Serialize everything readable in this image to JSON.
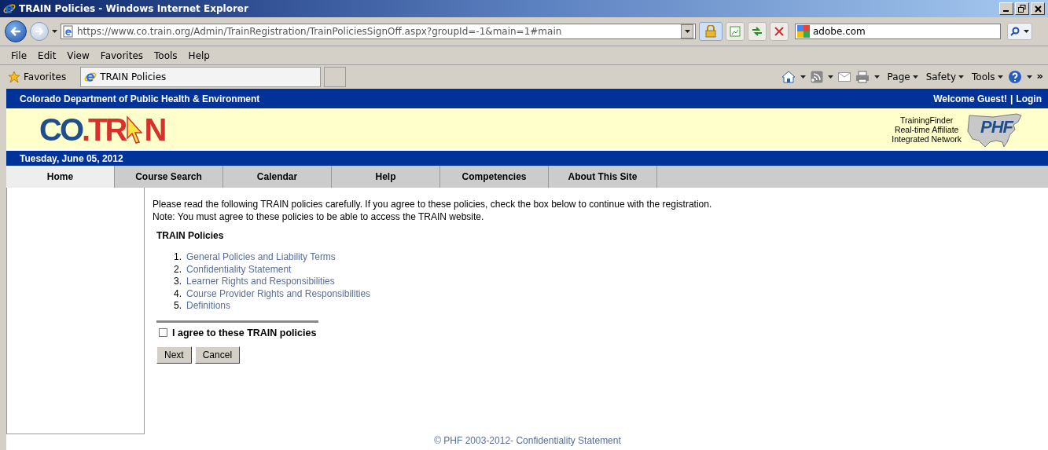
{
  "window": {
    "title": "TRAIN Policies - Windows Internet Explorer"
  },
  "address_bar": {
    "url": "https://www.co.train.org/Admin/TrainRegistration/TrainPoliciesSignOff.aspx?groupId=-1&main=1#main"
  },
  "search": {
    "value": "adobe.com"
  },
  "menu": [
    "File",
    "Edit",
    "View",
    "Favorites",
    "Tools",
    "Help"
  ],
  "favorites_bar": {
    "favorites": "Favorites",
    "tabs": [
      {
        "label": "TRAIN Policies",
        "selected": true
      }
    ],
    "commands": [
      "Page",
      "Safety",
      "Tools"
    ],
    "more": "»"
  },
  "site_header": {
    "agency": "Colorado Department of Public Health & Environment",
    "welcome": "Welcome Guest!",
    "separator": "|",
    "login": "Login"
  },
  "logo": {
    "blue": "CO",
    "red_left": ".TR",
    "red_right": "N"
  },
  "phf": {
    "lines": [
      "TrainingFinder",
      "Real-time Affiliate",
      "Integrated Network"
    ],
    "mark": "PHF"
  },
  "date": "Tuesday, June 05, 2012",
  "nav_tabs": [
    {
      "label": "Home",
      "selected": true
    },
    {
      "label": "Course Search",
      "selected": false
    },
    {
      "label": "Calendar",
      "selected": false
    },
    {
      "label": "Help",
      "selected": false
    },
    {
      "label": "Competencies",
      "selected": false
    },
    {
      "label": "About This Site",
      "selected": false
    }
  ],
  "intro": [
    "Please read the following TRAIN policies carefully. If you agree to these policies, check the box below to continue with the registration.",
    "Note: You must agree to these policies to be able to access the TRAIN website."
  ],
  "policies": {
    "heading": "TRAIN Policies",
    "items": [
      {
        "number": "1.",
        "label": "General Policies and Liability Terms"
      },
      {
        "number": "2.",
        "label": "Confidentiality Statement"
      },
      {
        "number": "3.",
        "label": "Learner Rights and Responsibilities"
      },
      {
        "number": "4.",
        "label": "Course Provider Rights and Responsibilities"
      },
      {
        "number": "5.",
        "label": "Definitions"
      }
    ]
  },
  "agree": {
    "label": "I agree to these TRAIN policies",
    "checked": false
  },
  "buttons": [
    "Next",
    "Cancel"
  ],
  "footer": "© PHF 2003-2012- Confidentiality Statement"
}
